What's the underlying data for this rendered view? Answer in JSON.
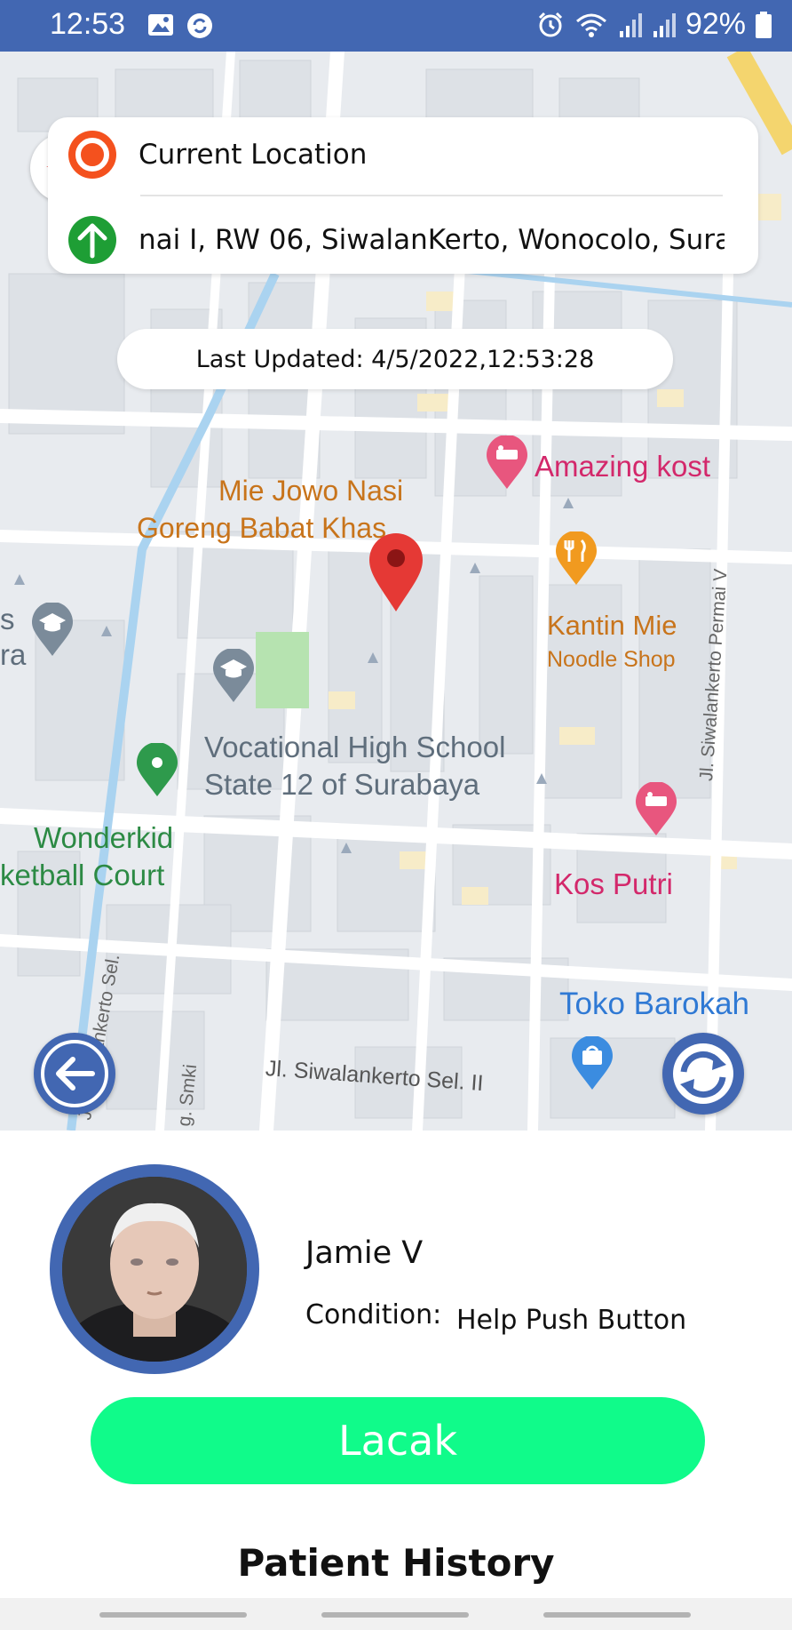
{
  "status_bar": {
    "time": "12:53",
    "battery": "92%",
    "icons": [
      "image-icon",
      "sync-app-icon",
      "alarm-icon",
      "wifi-icon",
      "signal-icon",
      "signal-icon",
      "battery-icon"
    ]
  },
  "location_card": {
    "origin_label": "Current Location",
    "destination_label": "nai I, RW 06, SiwalanKerto, Wonocolo, Sura"
  },
  "last_updated": "Last Updated: 4/5/2022,12:53:28",
  "map": {
    "labels": {
      "mie_jowo_1": "Mie Jowo Nasi",
      "mie_jowo_2": "Goreng Babat Khas",
      "amazing_kost": "Amazing kost",
      "kantin_mie": "Kantin Mie",
      "noodle_shop": "Noodle Shop",
      "vocational_1": "Vocational High School",
      "vocational_2": "State 12 of Surabaya",
      "wonderkid_1": "Wonderkid",
      "wonderkid_2": "ketball Court",
      "kos_putri": "Kos Putri",
      "toko_barokah": "Toko Barokah",
      "edge_left_1": "s",
      "edge_left_2": "ra",
      "street_1": "Jl. Siwalankerto Sel. II",
      "street_2": "Jl. Siwalankerto Permai V",
      "street_3": "Jl. Siwalankerto Sel.",
      "street_4": "g. Smki"
    }
  },
  "patient": {
    "name": "Jamie V",
    "condition_label": "Condition:",
    "condition_value": "Help Push Button"
  },
  "track_button": "Lacak",
  "history_title": "Patient History",
  "colors": {
    "primary": "#4267b2",
    "track_button": "#10fb8a",
    "origin_marker": "#f4511e",
    "destination_marker": "#1e9e35",
    "map_pin": "#e53935"
  }
}
